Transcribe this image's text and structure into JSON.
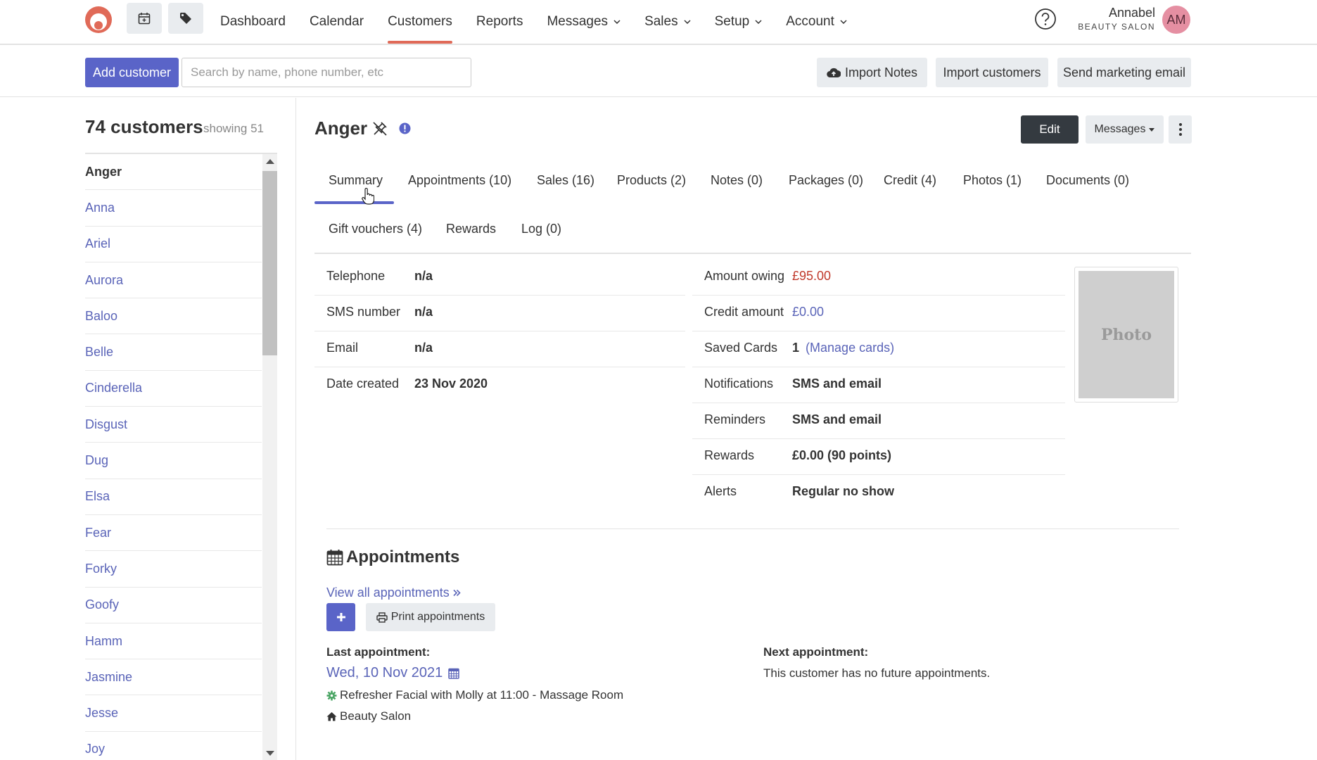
{
  "nav": {
    "items": [
      {
        "label": "Dashboard",
        "dropdown": false,
        "active": false
      },
      {
        "label": "Calendar",
        "dropdown": false,
        "active": false
      },
      {
        "label": "Customers",
        "dropdown": false,
        "active": true
      },
      {
        "label": "Reports",
        "dropdown": false,
        "active": false
      },
      {
        "label": "Messages",
        "dropdown": true,
        "active": false
      },
      {
        "label": "Sales",
        "dropdown": true,
        "active": false
      },
      {
        "label": "Setup",
        "dropdown": true,
        "active": false
      },
      {
        "label": "Account",
        "dropdown": true,
        "active": false
      }
    ],
    "user_name": "Annabel",
    "user_salon": "BEAUTY SALON",
    "avatar_initials": "AM"
  },
  "toolbar": {
    "add_customer": "Add customer",
    "search_placeholder": "Search by name, phone number, etc",
    "import_notes": "Import Notes",
    "import_customers": "Import customers",
    "send_marketing": "Send marketing email"
  },
  "customers": {
    "count": "74 customers",
    "showing": "showing 51",
    "list": [
      "Anger",
      "Anna",
      "Ariel",
      "Aurora",
      "Baloo",
      "Belle",
      "Cinderella",
      "Disgust",
      "Dug",
      "Elsa",
      "Fear",
      "Forky",
      "Goofy",
      "Hamm",
      "Jasmine",
      "Jesse",
      "Joy"
    ],
    "selected": "Anger"
  },
  "profile": {
    "name": "Anger",
    "edit": "Edit",
    "messages": "Messages",
    "tabs_row1": [
      "Summary",
      "Appointments (10)",
      "Sales (16)",
      "Products (2)",
      "Notes (0)",
      "Packages (0)",
      "Credit (4)",
      "Photos (1)",
      "Documents (0)"
    ],
    "tabs_row2": [
      "Gift vouchers (4)",
      "Rewards",
      "Log (0)"
    ],
    "active_tab": "Summary",
    "details_left": [
      {
        "label": "Telephone",
        "value": "n/a"
      },
      {
        "label": "SMS number",
        "value": "n/a"
      },
      {
        "label": "Email",
        "value": "n/a"
      },
      {
        "label": "Date created",
        "value": "23 Nov 2020"
      }
    ],
    "details_right": {
      "amount_owing_label": "Amount owing",
      "amount_owing": "£95.00",
      "credit_label": "Credit amount",
      "credit": "£0.00",
      "saved_cards_label": "Saved Cards",
      "saved_cards": "1",
      "manage_cards": "(Manage cards)",
      "notifications_label": "Notifications",
      "notifications": "SMS and email",
      "reminders_label": "Reminders",
      "reminders": "SMS and email",
      "rewards_label": "Rewards",
      "rewards": "£0.00 (90 points)",
      "alerts_label": "Alerts",
      "alerts": "Regular no show"
    },
    "photo_label": "Photo"
  },
  "appointments": {
    "heading": "Appointments",
    "view_all": "View all appointments",
    "print": "Print appointments",
    "last_label": "Last appointment:",
    "last_date": "Wed, 10 Nov 2021",
    "last_service": "Refresher Facial with Molly at 11:00 - Massage Room",
    "last_location": "Beauty Salon",
    "next_label": "Next appointment:",
    "next_text": "This customer has no future appointments."
  },
  "colors": {
    "primary": "#5a64c8",
    "accent_logo": "#e06a58",
    "owing": "#c0392b",
    "link": "#5a64b8"
  }
}
